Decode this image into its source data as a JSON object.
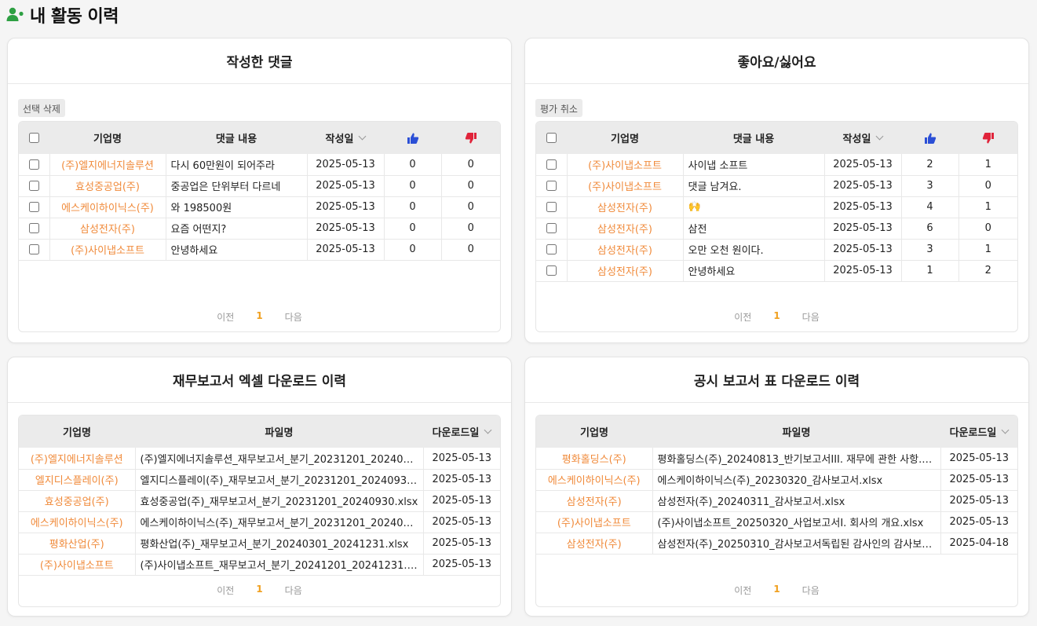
{
  "page": {
    "title": "내 활동 이력"
  },
  "comments": {
    "title": "작성한 댓글",
    "action_label": "선택 삭제",
    "headers": {
      "company": "기업명",
      "content": "댓글 내용",
      "date": "작성일"
    },
    "rows": [
      {
        "company": "(주)엘지에너지솔루션",
        "content": "다시 60만원이 되어주라",
        "date": "2025-05-13",
        "likes": "0",
        "dislikes": "0"
      },
      {
        "company": "효성중공업(주)",
        "content": "중공업은 단위부터 다르네",
        "date": "2025-05-13",
        "likes": "0",
        "dislikes": "0"
      },
      {
        "company": "에스케이하이닉스(주)",
        "content": "와 198500원",
        "date": "2025-05-13",
        "likes": "0",
        "dislikes": "0"
      },
      {
        "company": "삼성전자(주)",
        "content": "요즘 어떤지?",
        "date": "2025-05-13",
        "likes": "0",
        "dislikes": "0"
      },
      {
        "company": "(주)사이냅소프트",
        "content": "안녕하세요",
        "date": "2025-05-13",
        "likes": "0",
        "dislikes": "0"
      }
    ],
    "pager": {
      "prev": "이전",
      "current": "1",
      "next": "다음"
    }
  },
  "reactions": {
    "title": "좋아요/싫어요",
    "action_label": "평가 취소",
    "headers": {
      "company": "기업명",
      "content": "댓글 내용",
      "date": "작성일"
    },
    "rows": [
      {
        "company": "(주)사이냅소프트",
        "content": "사이냅 소프트",
        "date": "2025-05-13",
        "likes": "2",
        "dislikes": "1"
      },
      {
        "company": "(주)사이냅소프트",
        "content": "댓글 남겨요.",
        "date": "2025-05-13",
        "likes": "3",
        "dislikes": "0"
      },
      {
        "company": "삼성전자(주)",
        "content": "🙌",
        "date": "2025-05-13",
        "likes": "4",
        "dislikes": "1"
      },
      {
        "company": "삼성전자(주)",
        "content": "삼전",
        "date": "2025-05-13",
        "likes": "6",
        "dislikes": "0"
      },
      {
        "company": "삼성전자(주)",
        "content": "오만 오천 원이다.",
        "date": "2025-05-13",
        "likes": "3",
        "dislikes": "1"
      },
      {
        "company": "삼성전자(주)",
        "content": "안녕하세요",
        "date": "2025-05-13",
        "likes": "1",
        "dislikes": "2"
      }
    ],
    "pager": {
      "prev": "이전",
      "current": "1",
      "next": "다음"
    }
  },
  "financial_downloads": {
    "title": "재무보고서 엑셀 다운로드 이력",
    "headers": {
      "company": "기업명",
      "file": "파일명",
      "date": "다운로드일"
    },
    "rows": [
      {
        "company": "(주)엘지에너지솔루션",
        "file": "(주)엘지에너지솔루션_재무보고서_분기_20231201_2024093...",
        "date": "2025-05-13"
      },
      {
        "company": "엘지디스플레이(주)",
        "file": "엘지디스플레이(주)_재무보고서_분기_20231201_20240930....",
        "date": "2025-05-13"
      },
      {
        "company": "효성중공업(주)",
        "file": "효성중공업(주)_재무보고서_분기_20231201_20240930.xlsx",
        "date": "2025-05-13"
      },
      {
        "company": "에스케이하이닉스(주)",
        "file": "에스케이하이닉스(주)_재무보고서_분기_20231201_2024093...",
        "date": "2025-05-13"
      },
      {
        "company": "평화산업(주)",
        "file": "평화산업(주)_재무보고서_분기_20240301_20241231.xlsx",
        "date": "2025-05-13"
      },
      {
        "company": "(주)사이냅소프트",
        "file": "(주)사이냅소프트_재무보고서_분기_20241201_20241231.xlsx",
        "date": "2025-05-13"
      }
    ],
    "pager": {
      "prev": "이전",
      "current": "1",
      "next": "다음"
    }
  },
  "disclosure_downloads": {
    "title": "공시 보고서 표 다운로드 이력",
    "headers": {
      "company": "기업명",
      "file": "파일명",
      "date": "다운로드일"
    },
    "rows": [
      {
        "company": "평화홀딩스(주)",
        "file": "평화홀딩스(주)_20240813_반기보고서III. 재무에 관한 사항.xlsx",
        "date": "2025-05-13"
      },
      {
        "company": "에스케이하이닉스(주)",
        "file": "에스케이하이닉스(주)_20230320_감사보고서.xlsx",
        "date": "2025-05-13"
      },
      {
        "company": "삼성전자(주)",
        "file": "삼성전자(주)_20240311_감사보고서.xlsx",
        "date": "2025-05-13"
      },
      {
        "company": "(주)사이냅소프트",
        "file": "(주)사이냅소프트_20250320_사업보고서I. 회사의 개요.xlsx",
        "date": "2025-05-13"
      },
      {
        "company": "삼성전자(주)",
        "file": "삼성전자(주)_20250310_감사보고서독립된 감사인의 감사보고...",
        "date": "2025-04-18"
      }
    ],
    "pager": {
      "prev": "이전",
      "current": "1",
      "next": "다음"
    }
  },
  "colors": {
    "company_link": "#f08a3a",
    "pager_current": "#f0a020",
    "like_icon": "#2b4fd6",
    "dislike_icon": "#e0233a",
    "user_icon": "#2ea043"
  },
  "icons": {
    "header": "user-plus-icon",
    "like": "thumbs-up-icon",
    "dislike": "thumbs-down-icon",
    "sort": "chevron-down-icon"
  }
}
